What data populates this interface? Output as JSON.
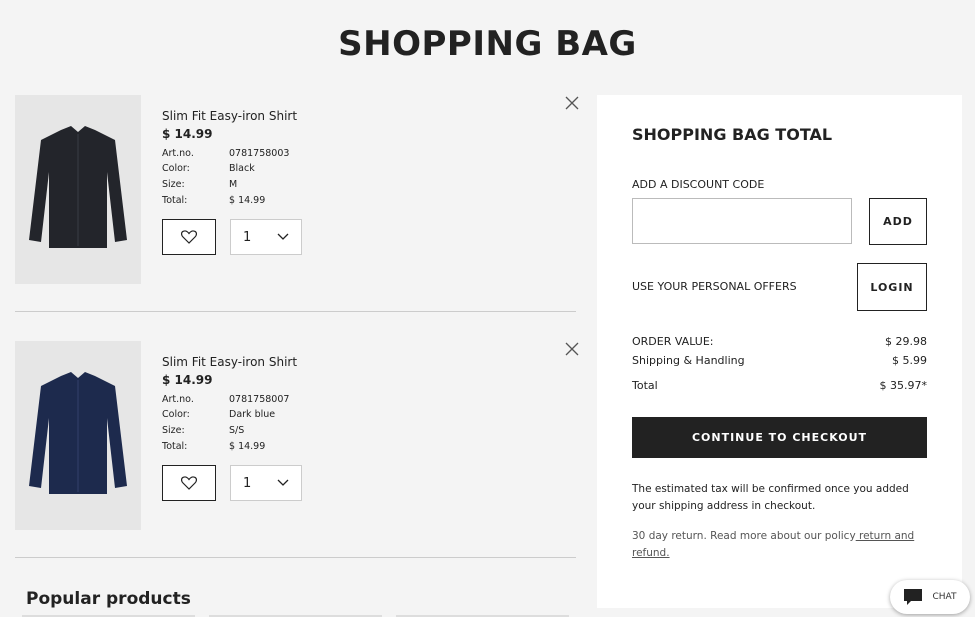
{
  "page": {
    "title": "SHOPPING BAG"
  },
  "items": [
    {
      "name": "Slim Fit Easy-iron Shirt",
      "price": "$ 14.99",
      "art_label": "Art.no.",
      "art_no": "0781758003",
      "color_label": "Color:",
      "color": "Black",
      "size_label": "Size:",
      "size": "M",
      "total_label": "Total:",
      "total": "$ 14.99",
      "quantity": "1",
      "shirt_color": "#23252b"
    },
    {
      "name": "Slim Fit Easy-iron Shirt",
      "price": "$ 14.99",
      "art_label": "Art.no.",
      "art_no": "0781758007",
      "color_label": "Color:",
      "color": "Dark blue",
      "size_label": "Size:",
      "size": "S/S",
      "total_label": "Total:",
      "total": "$ 14.99",
      "quantity": "1",
      "shirt_color": "#1d2a4d"
    }
  ],
  "popular": {
    "title": "Popular products"
  },
  "summary": {
    "title": "SHOPPING BAG TOTAL",
    "discount_label": "ADD A DISCOUNT CODE",
    "discount_value": "",
    "add_label": "ADD",
    "offers_label": "USE YOUR PERSONAL OFFERS",
    "login_label": "LOGIN",
    "order_value_label": "ORDER VALUE:",
    "order_value": "$ 29.98",
    "shipping_label": "Shipping & Handling",
    "shipping_value": "$ 5.99",
    "total_label": "Total",
    "total_value": "$ 35.97*",
    "checkout_label": "CONTINUE TO CHECKOUT",
    "tax_note": "The estimated tax will be confirmed once you added your shipping address in checkout.",
    "return_text": "30 day return. Read more about our policy",
    "return_link": " return and refund."
  },
  "chat": {
    "label": "CHAT",
    "icon": "chat-bubble-icon"
  }
}
